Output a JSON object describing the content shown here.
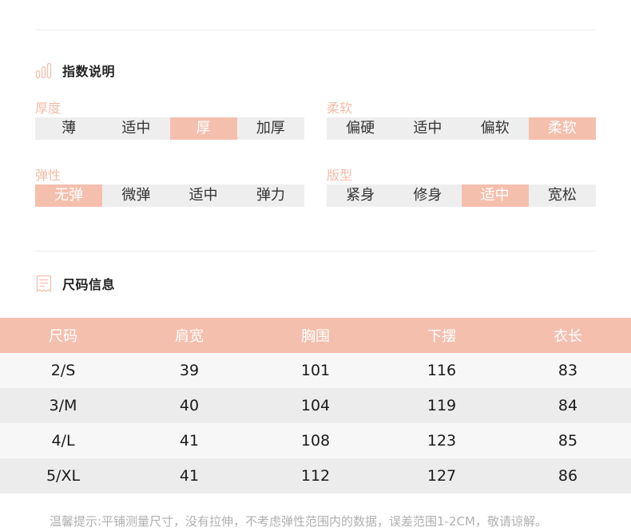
{
  "index_section": {
    "title": "指数说明"
  },
  "indices": [
    {
      "label": "厚度",
      "options": [
        "薄",
        "适中",
        "厚",
        "加厚"
      ],
      "selected": 2
    },
    {
      "label": "柔软",
      "options": [
        "偏硬",
        "适中",
        "偏软",
        "柔软"
      ],
      "selected": 3
    },
    {
      "label": "弹性",
      "options": [
        "无弹",
        "微弹",
        "适中",
        "弹力"
      ],
      "selected": 0
    },
    {
      "label": "版型",
      "options": [
        "紧身",
        "修身",
        "适中",
        "宽松"
      ],
      "selected": 2
    }
  ],
  "size_section": {
    "title": "尺码信息"
  },
  "size_table": {
    "headers": [
      "尺码",
      "肩宽",
      "胸围",
      "下摆",
      "衣长"
    ],
    "rows": [
      [
        "2/S",
        "39",
        "101",
        "116",
        "83"
      ],
      [
        "3/M",
        "40",
        "104",
        "119",
        "84"
      ],
      [
        "4/L",
        "41",
        "108",
        "123",
        "85"
      ],
      [
        "5/XL",
        "41",
        "112",
        "127",
        "86"
      ]
    ]
  },
  "note": "温馨提示:平铺测量尺寸，没有拉伸，不考虑弹性范围内的数据，误差范围1-2CM，敬请谅解。",
  "colors": {
    "accent": "#f5bfae",
    "label": "#f3bca8",
    "bar_bg": "#eeeeee"
  }
}
